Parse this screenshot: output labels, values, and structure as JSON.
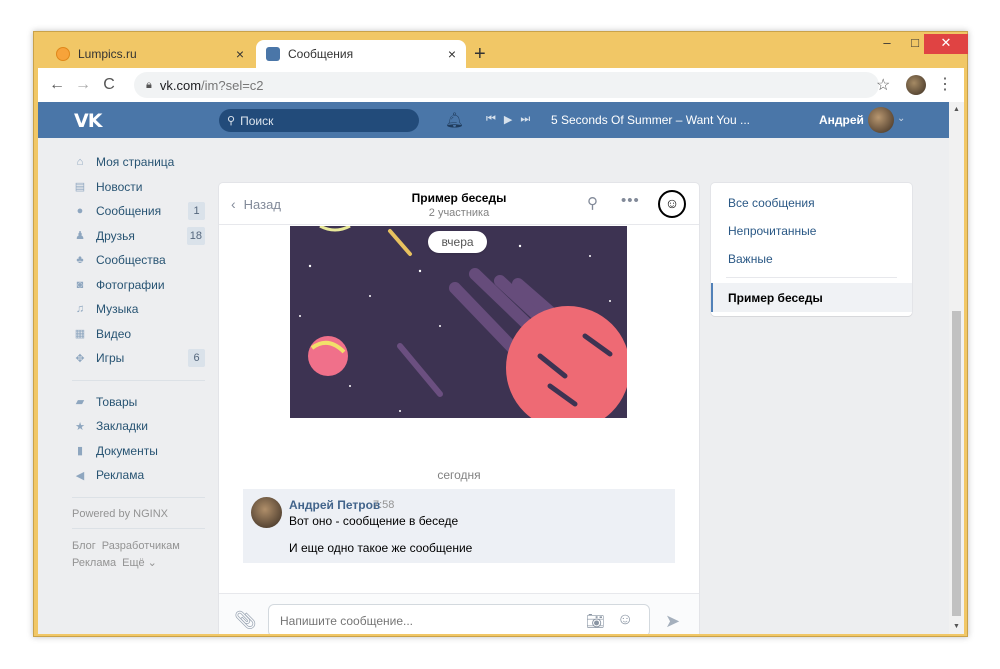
{
  "browser": {
    "tabs": [
      {
        "title": "Lumpics.ru",
        "close": "×"
      },
      {
        "title": "Сообщения",
        "close": "×"
      }
    ],
    "new_tab": "+",
    "window_controls": {
      "min": "–",
      "max": "□",
      "close": "✕"
    },
    "nav": {
      "back": "←",
      "forward": "→",
      "reload": "C"
    },
    "url": {
      "host": "vk.com",
      "path": "/im?sel=c2"
    },
    "star": "☆",
    "menu": "⋮"
  },
  "vk_header": {
    "logo": "VK",
    "search_placeholder": "Поиск",
    "bell_icon": "bell-icon",
    "player": {
      "prev": "⏮",
      "play": "▶",
      "next": "⏭"
    },
    "track": "5 Seconds Of Summer – Want You ...",
    "user_name": "Андрей",
    "chevron": "⌄"
  },
  "left_nav": {
    "items": [
      {
        "label": "Моя страница",
        "count": "",
        "icon": "home-icon"
      },
      {
        "label": "Новости",
        "count": "",
        "icon": "news-icon"
      },
      {
        "label": "Сообщения",
        "count": "1",
        "icon": "messages-icon"
      },
      {
        "label": "Друзья",
        "count": "18",
        "icon": "friends-icon"
      },
      {
        "label": "Сообщества",
        "count": "",
        "icon": "communities-icon"
      },
      {
        "label": "Фотографии",
        "count": "",
        "icon": "photos-icon"
      },
      {
        "label": "Музыка",
        "count": "",
        "icon": "music-icon"
      },
      {
        "label": "Видео",
        "count": "",
        "icon": "video-icon"
      },
      {
        "label": "Игры",
        "count": "6",
        "icon": "games-icon"
      }
    ],
    "items2": [
      {
        "label": "Товары",
        "icon": "goods-icon"
      },
      {
        "label": "Закладки",
        "icon": "bookmarks-icon"
      },
      {
        "label": "Документы",
        "icon": "documents-icon"
      },
      {
        "label": "Реклама",
        "icon": "ads-icon"
      }
    ],
    "powered_by": "Powered by NGINX",
    "footer": {
      "blog": "Блог",
      "developers": "Разработчикам",
      "ads": "Реклама",
      "more": "Ещё ⌄"
    }
  },
  "chat": {
    "back": "Назад",
    "title": "Пример беседы",
    "subtitle": "2 участника",
    "date_pill": "вчера",
    "day_separator": "сегодня",
    "message": {
      "author": "Андрей Петров",
      "time": "7:58",
      "lines": [
        "Вот оно - сообщение в беседе",
        "И еще одно такое же сообщение"
      ]
    },
    "composer_placeholder": "Напишите сообщение..."
  },
  "right_panel": {
    "items": [
      "Все сообщения",
      "Непрочитанные",
      "Важные"
    ],
    "active": "Пример беседы"
  },
  "colors": {
    "vk_blue": "#4a76a8",
    "link": "#2a5885",
    "chrome_frame": "#f1c766"
  }
}
